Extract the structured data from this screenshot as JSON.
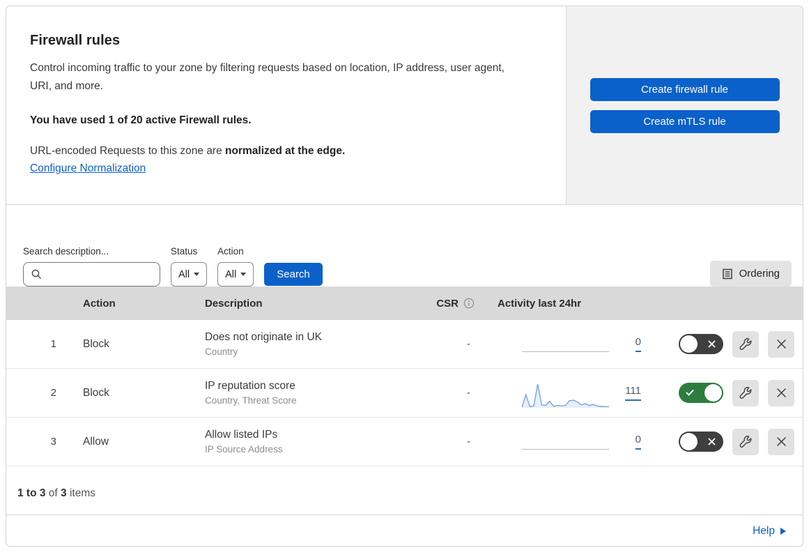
{
  "colors": {
    "primary_blue": "#0b61ca",
    "link_blue": "#0b61ca",
    "toggle_on_green": "#2e7d3e",
    "toggle_off_gray": "#3f3f3f",
    "table_header_bg": "#d9d9d9",
    "side_panel_bg": "#f1f1f1",
    "gray_button_bg": "#e2e2e2",
    "sparkline_blue": "#76a5e3"
  },
  "header": {
    "title": "Firewall rules",
    "description": "Control incoming traffic to your zone by filtering requests based on location, IP address, user agent, URI, and more.",
    "usage_note": "You have used 1 of 20 active Firewall rules.",
    "normalization_text": "URL-encoded Requests to this zone are ",
    "normalization_bold": "normalized at the edge.",
    "normalization_link": "Configure Normalization",
    "create_firewall_button": "Create firewall rule",
    "create_mtls_button": "Create mTLS rule"
  },
  "filters": {
    "search_label": "Search description...",
    "search_value": "",
    "status_label": "Status",
    "status_value": "All",
    "action_label": "Action",
    "action_value": "All",
    "search_button": "Search",
    "ordering_button": "Ordering"
  },
  "table": {
    "columns": {
      "action": "Action",
      "description": "Description",
      "csr": "CSR",
      "activity": "Activity last 24hr"
    },
    "rows": [
      {
        "number": "1",
        "action": "Block",
        "description": "Does not originate in UK",
        "match_fields": "Country",
        "csr": "-",
        "activity_count": "0",
        "enabled": false
      },
      {
        "number": "2",
        "action": "Block",
        "description": "IP reputation score",
        "match_fields": "Country, Threat Score",
        "csr": "-",
        "activity_count": "111",
        "enabled": true
      },
      {
        "number": "3",
        "action": "Allow",
        "description": "Allow listed IPs",
        "match_fields": "IP Source Address",
        "csr": "-",
        "activity_count": "0",
        "enabled": false
      }
    ]
  },
  "chart_data": {
    "type": "line",
    "title": "Activity last 24hr sparkline (rule 2)",
    "values": [
      2,
      55,
      5,
      8,
      100,
      12,
      10,
      28,
      6,
      10,
      8,
      10,
      30,
      32,
      25,
      12,
      18,
      10,
      14,
      8,
      6,
      5,
      5
    ],
    "ylim": [
      0,
      100
    ],
    "note": "rules 1 and 3 sparklines are flat at 0"
  },
  "footer": {
    "range": "1 to 3",
    "of": "of",
    "total": "3",
    "items": "items"
  },
  "help": {
    "label": "Help"
  }
}
